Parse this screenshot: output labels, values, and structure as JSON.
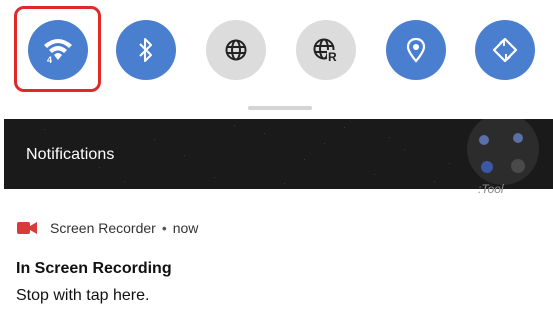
{
  "quick_settings": {
    "tiles": [
      {
        "name": "wifi",
        "icon": "wifi-icon",
        "badge": "4",
        "state": "on"
      },
      {
        "name": "bluetooth",
        "icon": "bluetooth-icon",
        "state": "on"
      },
      {
        "name": "globe",
        "icon": "globe-icon",
        "state": "off"
      },
      {
        "name": "globe-r",
        "icon": "globe-r-icon",
        "badge": "R",
        "state": "off"
      },
      {
        "name": "location",
        "icon": "location-icon",
        "state": "on"
      },
      {
        "name": "auto-rotate",
        "icon": "rotate-icon",
        "state": "on"
      }
    ],
    "highlight_color": "#e02a2a",
    "active_color": "#4a7fd0",
    "inactive_color": "#dcdcdc"
  },
  "notifications_header": {
    "title": "Notifications",
    "widget_label": ":Tool"
  },
  "notification": {
    "app_name": "Screen Recorder",
    "separator": "•",
    "time": "now",
    "title": "In Screen Recording",
    "body": "Stop with tap here.",
    "icon": "video-camera-icon",
    "icon_color": "#d93a3a"
  }
}
